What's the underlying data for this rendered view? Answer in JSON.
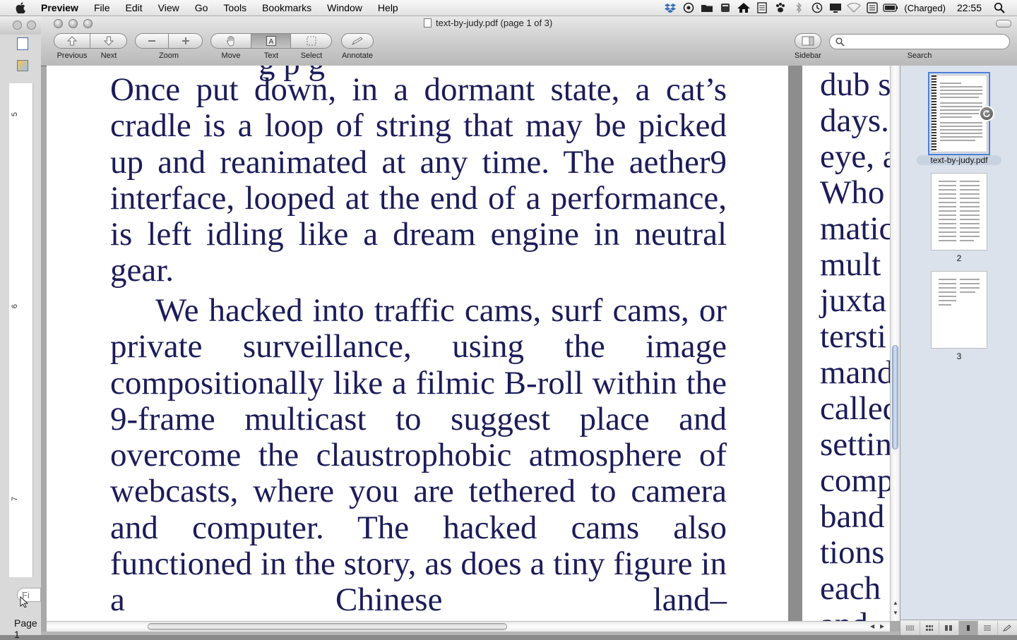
{
  "menubar": {
    "apple": "",
    "items": [
      "Preview",
      "File",
      "Edit",
      "View",
      "Go",
      "Tools",
      "Bookmarks",
      "Window",
      "Help"
    ],
    "battery_status": "(Charged)",
    "clock": "22:55",
    "status_icons": [
      "dropbox-icon",
      "sync-icon",
      "folder-icon",
      "stack-icon",
      "home-icon",
      "notes-icon",
      "paw-icon",
      "bluetooth-icon",
      "time-machine-icon",
      "display-icon",
      "wifi-icon",
      "keyboard-icon",
      "battery-icon",
      "spotlight-icon"
    ]
  },
  "window": {
    "title": "text-by-judy.pdf (page 1 of 3)"
  },
  "toolbar": {
    "previous": "Previous",
    "next": "Next",
    "zoom": "Zoom",
    "move": "Move",
    "text": "Text",
    "select": "Select",
    "annotate": "Annotate",
    "sidebar": "Sidebar",
    "search": "Search",
    "search_value": ""
  },
  "background_window": {
    "ruler_ticks": [
      "5",
      "6",
      "7"
    ],
    "find_placeholder": "Fi",
    "page_label": "Page 1",
    "toolbar_partial": "Pr"
  },
  "document": {
    "page1_top_fragment": "g    p    g",
    "paragraph1": "Once put down, in a dormant state, a cat’s cradle is a loop of string that may be picked up and reanimated at any time. The aether9 interface, looped at the end of a performance, is left idling like a dream engine in neutral gear.",
    "paragraph2": "We hacked into traffic cams, surf cams, or private surveillance, using the image compositionally like a filmic B-roll within the 9-frame multicast to suggest place and overcome the claustrophobic atmosphere of webcasts, where you are tethered to camera and computer. The hacked cams also functioned in the story, as does a tiny figure in a Chinese land–",
    "page2_lines": [
      "dub s",
      "days.",
      "eye, a",
      "Who",
      "matic",
      "mult",
      "juxta",
      "tersti",
      "mand",
      "called",
      "settin",
      "comp",
      "band",
      "tions",
      "each",
      "and"
    ]
  },
  "sidebar": {
    "thumbnails": [
      {
        "label": "text-by-judy.pdf",
        "selected": true
      },
      {
        "label": "2",
        "selected": false
      },
      {
        "label": "3",
        "selected": false
      }
    ]
  },
  "colors": {
    "text_ink": "#1c1c5a",
    "selection": "#4a7fd9",
    "sidebar_bg": "#dbe2ec"
  }
}
